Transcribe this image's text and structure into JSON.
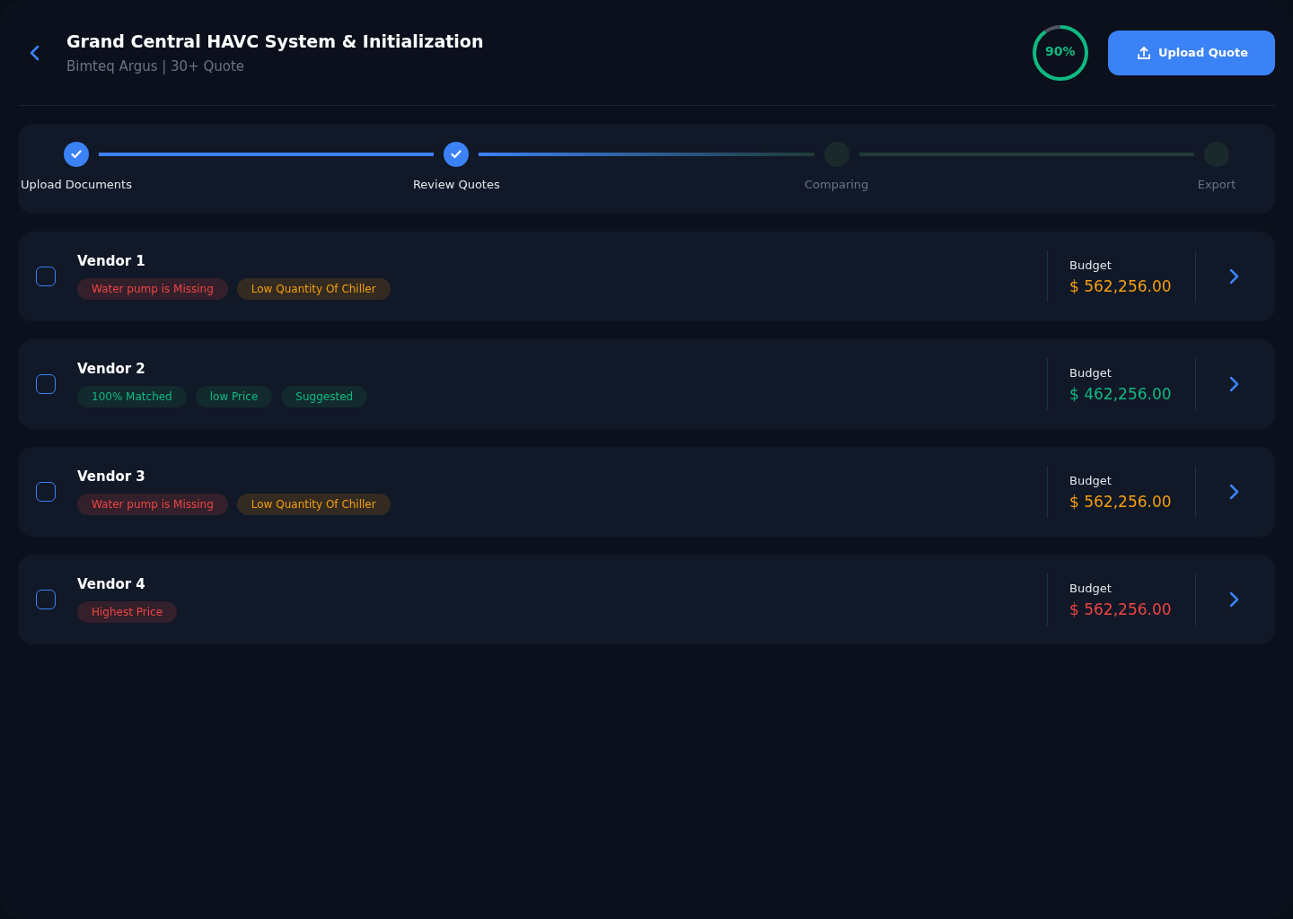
{
  "header": {
    "title": "Grand Central HAVC System & Initialization",
    "subtitle": "Bimteq Argus | 30+ Quote",
    "progress": {
      "label": "90%",
      "level": 0.9
    },
    "upload_button": "Upload Quote"
  },
  "steps": [
    {
      "label": "Upload Documents",
      "done": true
    },
    {
      "label": "Review Quotes",
      "done": true
    },
    {
      "label": "Comparing",
      "done": false
    },
    {
      "label": "Export",
      "done": false
    }
  ],
  "vendors": [
    {
      "name": "Vendor 1",
      "checked": false,
      "tags": [
        {
          "label": "Water pump is Missing",
          "kind": "error"
        },
        {
          "label": "Low Quantity Of Chiller",
          "kind": "warning"
        }
      ],
      "budget_label": "Budget",
      "budget": "$ 562,256.00",
      "color": "#f59e0b"
    },
    {
      "name": "Vendor 2",
      "checked": false,
      "tags": [
        {
          "label": "100% Matched",
          "kind": "success"
        },
        {
          "label": "low Price",
          "kind": "success"
        },
        {
          "label": "Suggested",
          "kind": "success"
        }
      ],
      "budget_label": "Budget",
      "budget": "$ 462,256.00",
      "color": "#10b981"
    },
    {
      "name": "Vendor 3",
      "checked": false,
      "tags": [
        {
          "label": "Water pump is Missing",
          "kind": "error"
        },
        {
          "label": "Low Quantity Of Chiller",
          "kind": "warning"
        }
      ],
      "budget_label": "Budget",
      "budget": "$ 562,256.00",
      "color": "#f59e0b"
    },
    {
      "name": "Vendor 4",
      "checked": false,
      "tags": [
        {
          "label": "Highest Price",
          "kind": "error"
        }
      ],
      "budget_label": "Budget",
      "budget": "$ 562,256.00",
      "color": "#ef4444"
    }
  ]
}
